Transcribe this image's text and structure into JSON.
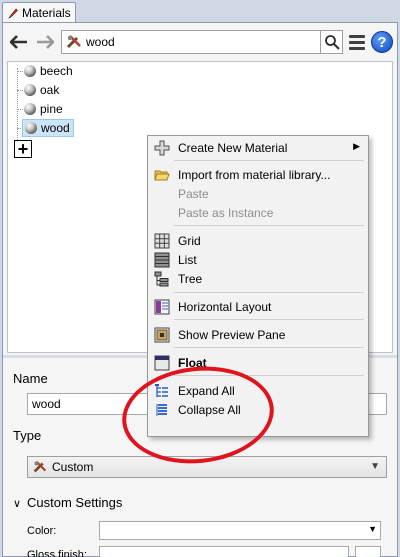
{
  "tab": {
    "label": "Materials",
    "icon": "brush-icon"
  },
  "toolbar": {
    "back_icon": "arrow-left-icon",
    "forward_icon": "arrow-right-icon",
    "search_value": "wood",
    "search_icon": "search-icon",
    "menu_icon": "hamburger-icon",
    "help_label": "?"
  },
  "tree": {
    "items": [
      {
        "label": "beech",
        "selected": false
      },
      {
        "label": "oak",
        "selected": false
      },
      {
        "label": "pine",
        "selected": false
      },
      {
        "label": "wood",
        "selected": true
      }
    ],
    "add_label": "+"
  },
  "context_menu": {
    "create_new": "Create New Material",
    "import": "Import from material library...",
    "paste": "Paste",
    "paste_instance": "Paste as Instance",
    "grid": "Grid",
    "list": "List",
    "tree": "Tree",
    "horizontal_layout": "Horizontal Layout",
    "show_preview": "Show Preview Pane",
    "float": "Float",
    "expand_all": "Expand All",
    "collapse_all": "Collapse All"
  },
  "editor": {
    "name_label": "Name",
    "name_value": "wood",
    "type_label": "Type",
    "type_value": "Custom",
    "custom_settings_label": "Custom Settings",
    "color_label": "Color:",
    "glossiness_label": "Gloss finish:"
  },
  "colors": {
    "annotation": "#e0141e",
    "selection": "#cce4f7",
    "background": "#cfd9e6"
  }
}
